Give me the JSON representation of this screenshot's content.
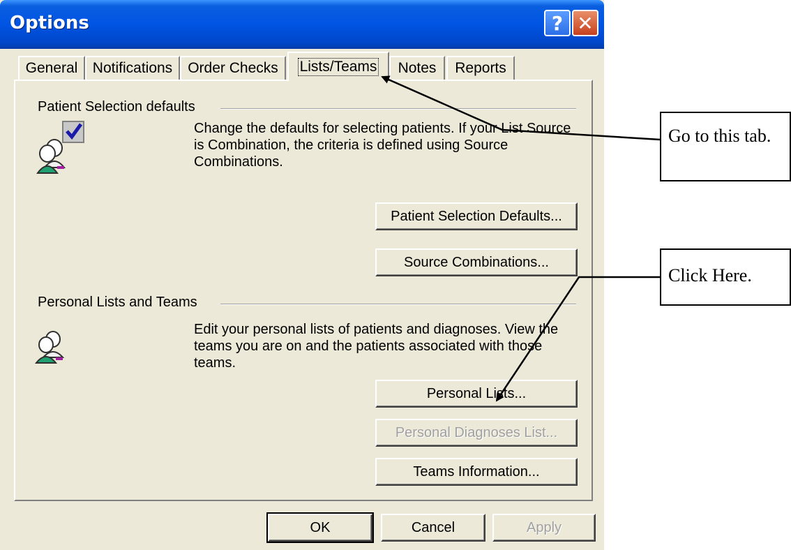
{
  "window": {
    "title": "Options",
    "help_label": "?",
    "close_label": "✕"
  },
  "tabs": [
    {
      "label": "General",
      "active": false
    },
    {
      "label": "Notifications",
      "active": false
    },
    {
      "label": "Order Checks",
      "active": false
    },
    {
      "label": "Lists/Teams",
      "active": true
    },
    {
      "label": "Notes",
      "active": false
    },
    {
      "label": "Reports",
      "active": false
    }
  ],
  "patient_selection": {
    "group_label": "Patient Selection defaults",
    "icon": "patient-checkbox-icon",
    "description": "Change the defaults for selecting patients. If your List Source is Combination, the criteria is defined using Source Combinations.",
    "buttons": {
      "defaults_label": "Patient Selection Defaults...",
      "combinations_label": "Source Combinations..."
    }
  },
  "personal_lists": {
    "group_label": "Personal Lists and Teams",
    "icon": "patients-icon",
    "description": "Edit your personal lists of patients and diagnoses. View the teams you are on and the patients associated with those teams.",
    "buttons": {
      "personal_lists_label": "Personal Lists...",
      "diagnoses_label": "Personal Diagnoses List...",
      "teams_label": "Teams Information..."
    }
  },
  "footer": {
    "ok_label": "OK",
    "cancel_label": "Cancel",
    "apply_label": "Apply"
  },
  "annotations": {
    "tab_callout": "Go to this tab.",
    "click_callout": "Click Here."
  },
  "colors": {
    "titlebar": "#0054e3",
    "dialog_bg": "#ece9d8",
    "disabled_text": "#a0a0a0"
  }
}
